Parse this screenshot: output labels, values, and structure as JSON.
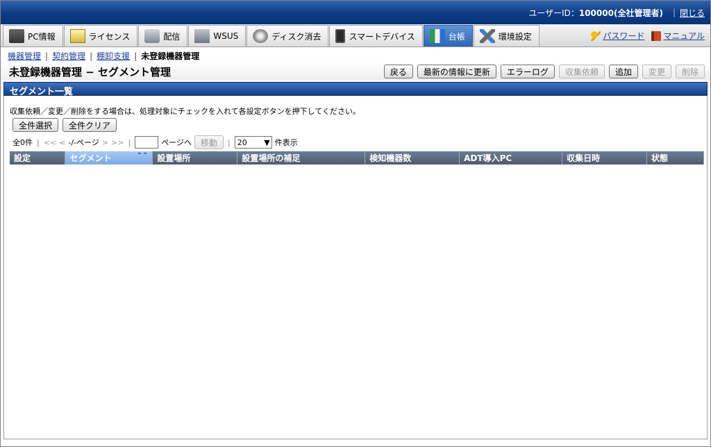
{
  "topbar": {
    "user_id_label": "ユーザーID：",
    "user_id_value": "100000(全社管理者)",
    "sep": "|",
    "close": "閉じる"
  },
  "tabs": [
    {
      "label": "PC情報",
      "icon": "pc-icon",
      "active": false
    },
    {
      "label": "ライセンス",
      "icon": "license-icon",
      "active": false
    },
    {
      "label": "配信",
      "icon": "distribution-icon",
      "active": false
    },
    {
      "label": "WSUS",
      "icon": "wsus-icon",
      "active": false
    },
    {
      "label": "ディスク消去",
      "icon": "disk-erase-icon",
      "active": false
    },
    {
      "label": "スマートデバイス",
      "icon": "smart-device-icon",
      "active": false
    },
    {
      "label": "台帳",
      "icon": "ledger-icon",
      "active": true
    },
    {
      "label": "環境設定",
      "icon": "settings-icon",
      "active": false
    }
  ],
  "header_links": {
    "password": "パスワード",
    "manual": "マニュアル"
  },
  "breadcrumb": {
    "items": [
      "機器管理",
      "契約管理",
      "棚卸支援"
    ],
    "current": "未登録機器管理",
    "sep": "|"
  },
  "page": {
    "title": "未登録機器管理 − セグメント管理",
    "buttons": [
      {
        "label": "戻る",
        "enabled": true
      },
      {
        "label": "最新の情報に更新",
        "enabled": true
      },
      {
        "label": "エラーログ",
        "enabled": true
      },
      {
        "label": "収集依頼",
        "enabled": false
      },
      {
        "label": "追加",
        "enabled": true
      },
      {
        "label": "変更",
        "enabled": false
      },
      {
        "label": "削除",
        "enabled": false
      }
    ]
  },
  "section": {
    "title": "セグメント一覧",
    "instruction": "収集依頼／変更／削除をする場合は、処理対象にチェックを入れて各設定ボタンを押下してください。",
    "select_all": "全件選択",
    "clear_all": "全件クリア",
    "pager": {
      "total": "全0件",
      "first": "<<",
      "prev": "<",
      "page_info": "-/-ページ",
      "next": ">",
      "last": ">>",
      "page_input_value": "",
      "goto_label": "ページへ",
      "move_button": "移動",
      "per_page_value": "20",
      "per_page_label": "件表示"
    },
    "columns": [
      "設定",
      "セグメント",
      "設置場所",
      "設置場所の補足",
      "検知機器数",
      "ADT導入PC",
      "収集日時",
      "状態"
    ],
    "rows": []
  }
}
